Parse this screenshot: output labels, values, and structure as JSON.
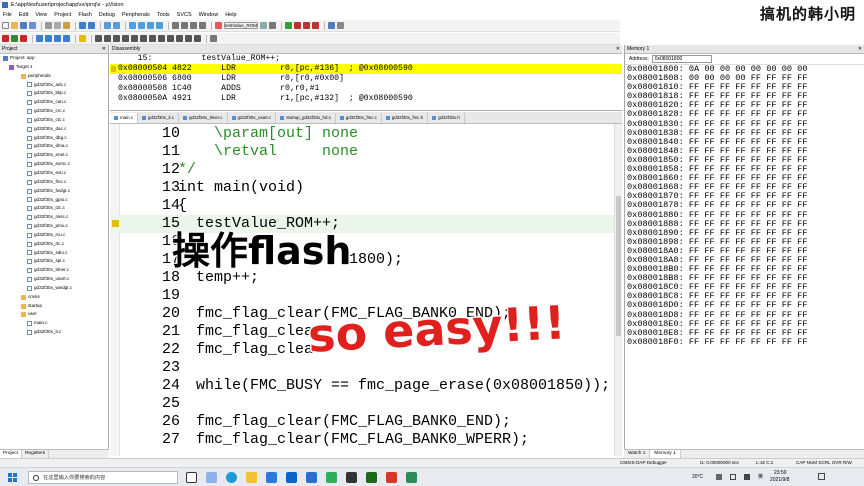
{
  "window": {
    "title": "E:\\app\\test\\user\\project\\app\\uv\\proj\\x - µVision"
  },
  "watermark": "搞机的韩小明",
  "menu": [
    "File",
    "Edit",
    "View",
    "Project",
    "Flash",
    "Debug",
    "Peripherals",
    "Tools",
    "SVCS",
    "Window",
    "Help"
  ],
  "toolbar": {
    "search_value": "testValue_ROM",
    "target": "Target 1"
  },
  "project": {
    "title": "Project",
    "root": "Project: app",
    "target": "Target 1",
    "items": [
      {
        "label": "peripherals",
        "type": "folder",
        "indent": 3
      },
      {
        "label": "gd32f30x_adc.c",
        "type": "file",
        "indent": 4
      },
      {
        "label": "gd32f30x_bkp.c",
        "type": "file",
        "indent": 4
      },
      {
        "label": "gd32f30x_can.c",
        "type": "file",
        "indent": 4
      },
      {
        "label": "gd32f30x_crc.c",
        "type": "file",
        "indent": 4
      },
      {
        "label": "gd32f30x_ctc.c",
        "type": "file",
        "indent": 4
      },
      {
        "label": "gd32f30x_dac.c",
        "type": "file",
        "indent": 4
      },
      {
        "label": "gd32f30x_dbg.c",
        "type": "file",
        "indent": 4
      },
      {
        "label": "gd32f30x_dma.c",
        "type": "file",
        "indent": 4
      },
      {
        "label": "gd32f30x_enet.c",
        "type": "file",
        "indent": 4
      },
      {
        "label": "gd32f30x_exmc.c",
        "type": "file",
        "indent": 4
      },
      {
        "label": "gd32f30x_exti.c",
        "type": "file",
        "indent": 4
      },
      {
        "label": "gd32f30x_fmc.c",
        "type": "file",
        "indent": 4
      },
      {
        "label": "gd32f30x_fwdgt.c",
        "type": "file",
        "indent": 4
      },
      {
        "label": "gd32f30x_gpio.c",
        "type": "file",
        "indent": 4
      },
      {
        "label": "gd32f30x_i2c.c",
        "type": "file",
        "indent": 4
      },
      {
        "label": "gd32f30x_misc.c",
        "type": "file",
        "indent": 4
      },
      {
        "label": "gd32f30x_pmu.c",
        "type": "file",
        "indent": 4
      },
      {
        "label": "gd32f30x_rcu.c",
        "type": "file",
        "indent": 4
      },
      {
        "label": "gd32f30x_rtc.c",
        "type": "file",
        "indent": 4
      },
      {
        "label": "gd32f30x_sdio.c",
        "type": "file",
        "indent": 4
      },
      {
        "label": "gd32f30x_spi.c",
        "type": "file",
        "indent": 4
      },
      {
        "label": "gd32f30x_timer.c",
        "type": "file",
        "indent": 4
      },
      {
        "label": "gd32f30x_usart.c",
        "type": "file",
        "indent": 4
      },
      {
        "label": "gd32f30x_wwdgt.c",
        "type": "file",
        "indent": 4
      },
      {
        "label": "cmsis",
        "type": "folder",
        "indent": 3
      },
      {
        "label": "startup",
        "type": "folder",
        "indent": 3
      },
      {
        "label": "user",
        "type": "folder",
        "indent": 3
      },
      {
        "label": "main.c",
        "type": "file",
        "indent": 4
      },
      {
        "label": "gd32f30x_it.c",
        "type": "file",
        "indent": 4
      }
    ],
    "tabs": [
      "Project",
      "Registers"
    ]
  },
  "disassembly": {
    "title": "Disassembly",
    "rows": [
      {
        "text": "    15:          testValue_ROM++;",
        "hl": false
      },
      {
        "text": "0x08000504 4822      LDR         r0,[pc,#136]  ; @0x08000590",
        "hl": true
      },
      {
        "text": "0x08000506 6800      LDR         r0,[r0,#0x00]",
        "hl": false
      },
      {
        "text": "0x08000508 1C40      ADDS        r0,r0,#1",
        "hl": false
      },
      {
        "text": "0x0800050A 4921      LDR         r1,[pc,#132]  ; @0x08000590",
        "hl": false
      }
    ]
  },
  "file_tabs": [
    "main.c",
    "gd32f30x_it.c",
    "gd32f30x_timer.c",
    "gd32f30x_usart.c",
    "startup_gd32f30x_hd.s",
    "gd32f30x_fmc.c",
    "gd32f30x_fmc.h",
    "gd32f30x.h"
  ],
  "editor": {
    "lines": [
      {
        "n": "10",
        "code": "    \\param[out] none",
        "cls": "cm"
      },
      {
        "n": "11",
        "code": "    \\retval     none",
        "cls": "cm"
      },
      {
        "n": "12",
        "code": "*/",
        "cls": "cm"
      },
      {
        "n": "13",
        "code": "int main(void)",
        "cls": ""
      },
      {
        "n": "14",
        "code": "{",
        "cls": ""
      },
      {
        "n": "15",
        "code": "  testValue_ROM++;",
        "cls": "",
        "cur": true
      },
      {
        "n": "16",
        "code": "",
        "cls": ""
      },
      {
        "n": "17",
        "code": "                  01800);",
        "cls": ""
      },
      {
        "n": "18",
        "code": "  temp++;",
        "cls": ""
      },
      {
        "n": "19",
        "code": "",
        "cls": ""
      },
      {
        "n": "20",
        "code": "  fmc_flag_clear(FMC_FLAG_BANK0_END);",
        "cls": ""
      },
      {
        "n": "21",
        "code": "  fmc_flag_clea",
        "cls": ""
      },
      {
        "n": "22",
        "code": "  fmc_flag_clea",
        "cls": ""
      },
      {
        "n": "23",
        "code": "",
        "cls": ""
      },
      {
        "n": "24",
        "code": "  while(FMC_BUSY == fmc_page_erase(0x08001850));",
        "cls": ""
      },
      {
        "n": "25",
        "code": "",
        "cls": ""
      },
      {
        "n": "26",
        "code": "  fmc_flag_clear(FMC_FLAG_BANK0_END);",
        "cls": ""
      },
      {
        "n": "27",
        "code": "  fmc_flag_clear(FMC_FLAG_BANK0_WPERR);",
        "cls": ""
      }
    ]
  },
  "overlay": {
    "line1": "操作flash",
    "line2": "so easy!!!"
  },
  "memory": {
    "title": "Memory 1",
    "address_label": "Address:",
    "address_value": "0x08001800",
    "rows": [
      "0x08001800: 0A 00 00 00 00 00 00 00",
      "0x08001808: 00 00 00 00 FF FF FF FF",
      "0x08001810: FF FF FF FF FF FF FF FF",
      "0x08001818: FF FF FF FF FF FF FF FF",
      "0x08001820: FF FF FF FF FF FF FF FF",
      "0x08001828: FF FF FF FF FF FF FF FF",
      "0x08001830: FF FF FF FF FF FF FF FF",
      "0x08001838: FF FF FF FF FF FF FF FF",
      "0x08001840: FF FF FF FF FF FF FF FF",
      "0x08001848: FF FF FF FF FF FF FF FF",
      "0x08001850: FF FF FF FF FF FF FF FF",
      "0x08001858: FF FF FF FF FF FF FF FF",
      "0x08001860: FF FF FF FF FF FF FF FF",
      "0x08001868: FF FF FF FF FF FF FF FF",
      "0x08001870: FF FF FF FF FF FF FF FF",
      "0x08001878: FF FF FF FF FF FF FF FF",
      "0x08001880: FF FF FF FF FF FF FF FF",
      "0x08001888: FF FF FF FF FF FF FF FF",
      "0x08001890: FF FF FF FF FF FF FF FF",
      "0x08001898: FF FF FF FF FF FF FF FF",
      "0x080018A0: FF FF FF FF FF FF FF FF",
      "0x080018A8: FF FF FF FF FF FF FF FF",
      "0x080018B0: FF FF FF FF FF FF FF FF",
      "0x080018B8: FF FF FF FF FF FF FF FF",
      "0x080018C0: FF FF FF FF FF FF FF FF",
      "0x080018C8: FF FF FF FF FF FF FF FF",
      "0x080018D0: FF FF FF FF FF FF FF FF",
      "0x080018D8: FF FF FF FF FF FF FF FF",
      "0x080018E0: FF FF FF FF FF FF FF FF",
      "0x080018E8: FF FF FF FF FF FF FF FF",
      "0x080018F0: FF FF FF FF FF FF FF FF"
    ],
    "tabs": [
      "Watch 1",
      "Memory 1"
    ]
  },
  "status": {
    "debugger": "CMSIS-DAP Debugger",
    "time": "t1: 0.00000000 sec",
    "position": "L:15 C:1",
    "flags": "CAP  NUM  SCRL  OVR  R/W"
  },
  "taskbar": {
    "search_placeholder": "在这里输入你要搜索的内容",
    "weather": "20°C",
    "time": "23:50",
    "date": "2021/9/8",
    "ime": "英"
  },
  "colors": {
    "exec_highlight": "#ffff00",
    "overlay_red": "#e0201c",
    "comment": "#2a8c2a"
  }
}
